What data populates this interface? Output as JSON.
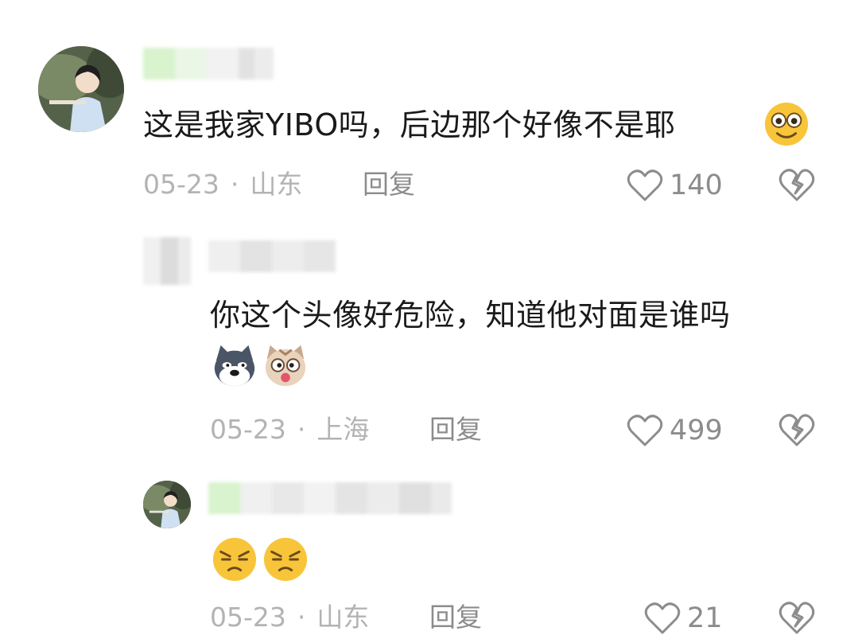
{
  "comments": [
    {
      "text": "这是我家YIBO吗，后边那个好像不是耶",
      "emoji": "smiling-face-emoji",
      "date": "05-23",
      "location": "山东",
      "reply_label": "回复",
      "likes": "140"
    },
    {
      "text": "你这个头像好危险，知道他对面是谁吗",
      "emojis": [
        "husky-dog-emoji",
        "shocked-cat-emoji"
      ],
      "date": "05-23",
      "location": "上海",
      "reply_label": "回复",
      "likes": "499"
    },
    {
      "emojis": [
        "annoyed-face-emoji",
        "annoyed-face-emoji"
      ],
      "date": "05-23",
      "location": "山东",
      "reply_label": "回复",
      "likes": "21"
    }
  ],
  "colors": {
    "meta_gray": "#b3b3b3",
    "action_gray": "#8c8c8c",
    "text": "#1a1a1a",
    "emoji_yellow": "#f8c53a"
  }
}
